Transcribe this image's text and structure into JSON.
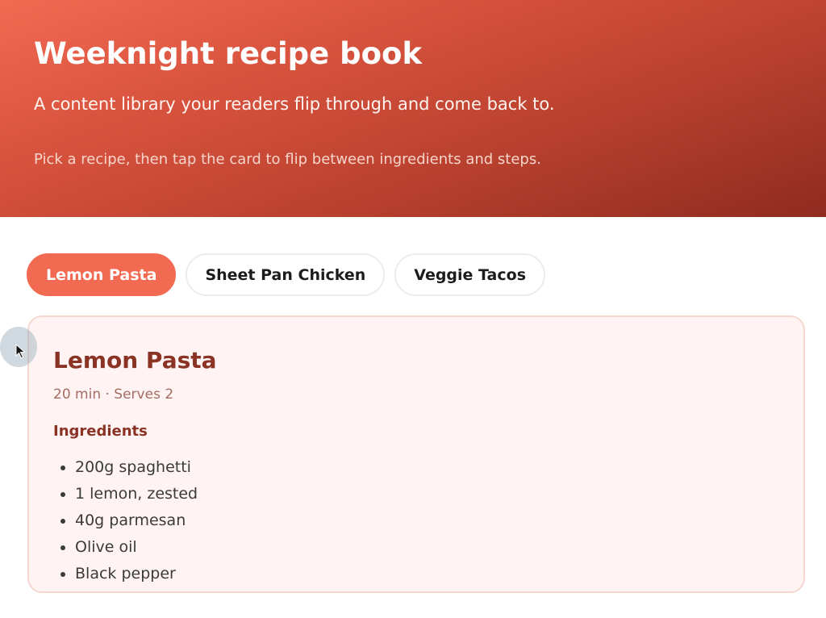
{
  "hero": {
    "title": "Weeknight recipe book",
    "subtitle": "A content library your readers flip through and come back to.",
    "hint": "Pick a recipe, then tap the card to flip between ingredients and steps."
  },
  "tabs": [
    {
      "label": "Lemon Pasta",
      "active": true
    },
    {
      "label": "Sheet Pan Chicken",
      "active": false
    },
    {
      "label": "Veggie Tacos",
      "active": false
    }
  ],
  "card": {
    "title": "Lemon Pasta",
    "meta": "20 min · Serves 2",
    "section_label": "Ingredients",
    "ingredients": [
      "200g spaghetti",
      "1 lemon, zested",
      "40g parmesan",
      "Olive oil",
      "Black pepper"
    ]
  },
  "colors": {
    "accent": "#f26a52",
    "hero_dark": "#8f2b1f",
    "card_title": "#8a3325",
    "card_bg": "#fff4f3"
  },
  "icons": {
    "cursor": "mouse-pointer-icon"
  }
}
